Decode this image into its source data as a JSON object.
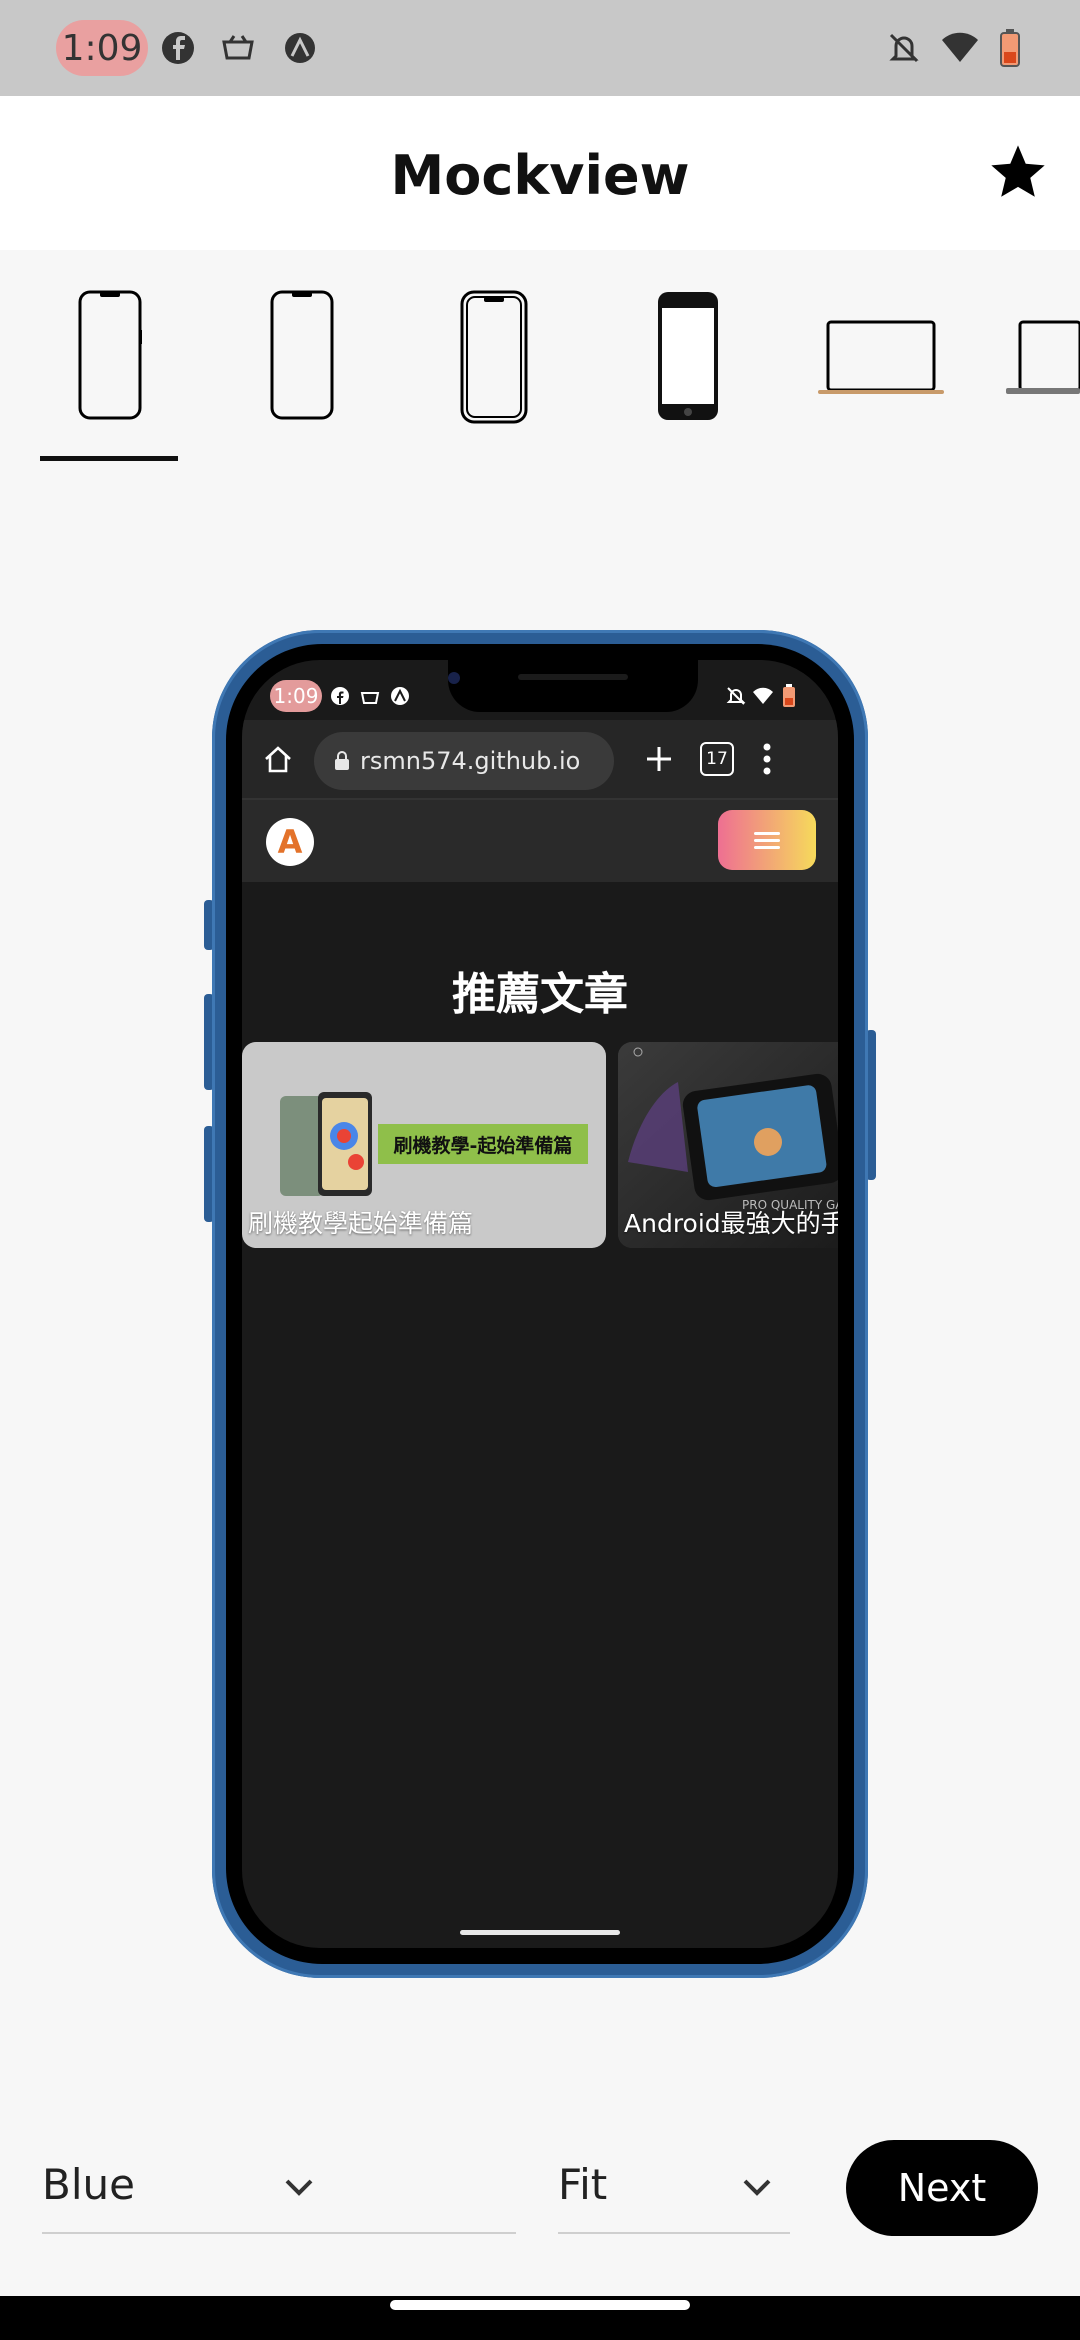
{
  "status_bar": {
    "time": "1:09",
    "icons": [
      "facebook-icon",
      "store-icon",
      "app-icon",
      "dnd-bell-off-icon",
      "wifi-icon",
      "battery-low-icon"
    ]
  },
  "app_bar": {
    "title": "Mockview",
    "favorite_icon": "star-icon"
  },
  "device_tabs": {
    "items": [
      {
        "name": "phone-notch-1",
        "selected": true
      },
      {
        "name": "phone-notch-2",
        "selected": false
      },
      {
        "name": "phone-notch-3",
        "selected": false
      },
      {
        "name": "phone-classic",
        "selected": false
      },
      {
        "name": "laptop",
        "selected": false
      },
      {
        "name": "laptop-partial",
        "selected": false
      }
    ]
  },
  "mockup": {
    "frame_color": "#2b5d95",
    "screen": {
      "status_time": "1:09",
      "url": "rsmn574.github.io",
      "tab_count": "17",
      "logo_letter": "A",
      "section_title": "推薦文章",
      "cards": [
        {
          "label": "刷機教學起始準備篇",
          "banner": "刷機教學-起始準備篇"
        },
        {
          "label": "Android最強大的手",
          "overlay": "PRO QUALITY GA"
        }
      ]
    }
  },
  "controls": {
    "color_select": {
      "value": "Blue"
    },
    "fit_select": {
      "value": "Fit"
    },
    "next_label": "Next"
  }
}
